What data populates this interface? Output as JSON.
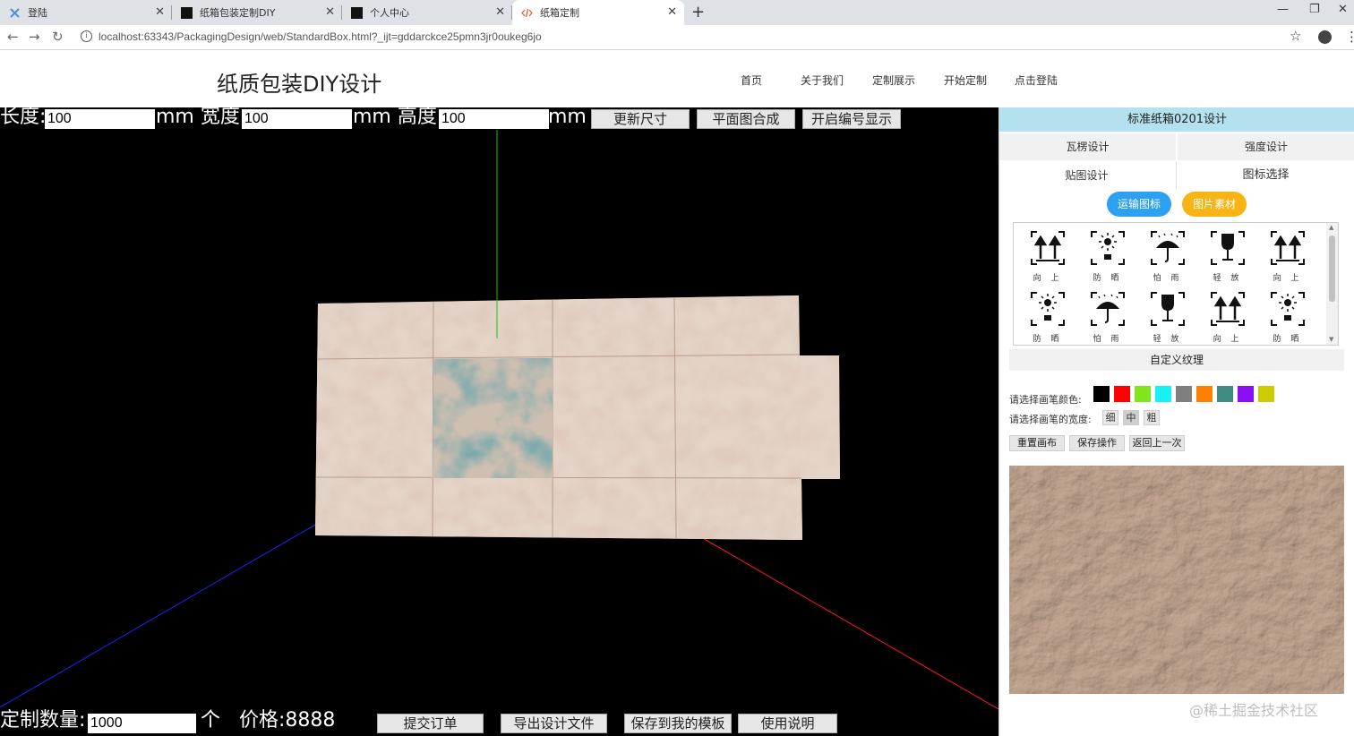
{
  "browser": {
    "tabs": [
      {
        "label": "登陆",
        "active": false
      },
      {
        "label": "纸箱包装定制DIY",
        "active": false
      },
      {
        "label": "个人中心",
        "active": false
      },
      {
        "label": "纸箱定制",
        "active": true
      }
    ],
    "new_tab_label": "+",
    "url": "localhost:63343/PackagingDesign/web/StandardBox.html?_ijt=gddarckce25pmn3jr0oukeg6jo"
  },
  "site": {
    "logo": "纸质包装DIY设计",
    "nav": [
      "首页",
      "关于我们",
      "定制展示",
      "开始定制",
      "点击登陆"
    ]
  },
  "toolbar": {
    "length_label": "长度:",
    "length_value": "100",
    "width_label": "mm 宽度:",
    "width_value": "100",
    "height_label": "mm 高度:",
    "height_value": "100",
    "unit": "mm",
    "update_size": "更新尺寸",
    "merge_flat": "平面图合成",
    "toggle_numbers": "开启编号显示"
  },
  "bottom_bar": {
    "quantity_label": "定制数量:",
    "quantity_value": "1000",
    "unit": "个",
    "price_label": "价格:8888",
    "submit_order": "提交订单",
    "export_design": "导出设计文件",
    "save_template": "保存到我的模板",
    "instructions": "使用说明"
  },
  "panel": {
    "title": "标准纸箱0201设计",
    "tabs": [
      "瓦楞设计",
      "强度设计",
      "贴图设计",
      "图标选择"
    ],
    "pill_transport": "运输图标",
    "pill_transport_color": "#2ea0f2",
    "pill_material": "图片素材",
    "pill_material_color": "#f8b315",
    "icons": [
      {
        "name": "arrows-up",
        "caption": "向 上"
      },
      {
        "name": "keep-from-sun",
        "caption": "防 晒"
      },
      {
        "name": "keep-dry",
        "caption": "怕 雨"
      },
      {
        "name": "fragile",
        "caption": "轻 放"
      },
      {
        "name": "arrows-up",
        "caption": "向 上"
      },
      {
        "name": "keep-from-sun",
        "caption": "防 晒"
      },
      {
        "name": "keep-dry",
        "caption": "怕 雨"
      },
      {
        "name": "fragile",
        "caption": "轻 放"
      },
      {
        "name": "arrows-up",
        "caption": "向 上"
      },
      {
        "name": "keep-from-sun",
        "caption": "防 晒"
      }
    ],
    "custom_texture": "自定义纹理",
    "pen_color_label": "请选择画笔颜色:",
    "pen_colors": [
      "#000000",
      "#ff0000",
      "#7fe51f",
      "#19f0f5",
      "#7f7f7f",
      "#ff7f00",
      "#3f8a83",
      "#8b0ff5",
      "#cccc00"
    ],
    "pen_width_label": "请选择画笔的宽度:",
    "pen_widths": [
      "细",
      "中",
      "粗"
    ],
    "reset_canvas": "重置画布",
    "save_action": "保存操作",
    "undo": "返回上一次"
  },
  "watermark": "@稀土掘金技术社区"
}
